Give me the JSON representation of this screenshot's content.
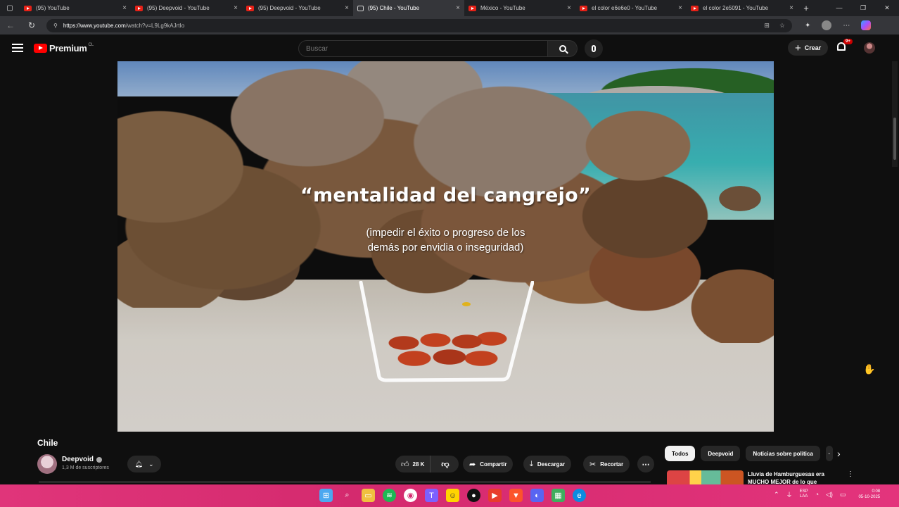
{
  "browser": {
    "tabs": [
      {
        "title": "(95) YouTube",
        "active": false,
        "audio": false
      },
      {
        "title": "(95) Deepvoid - YouTube",
        "active": false,
        "audio": false
      },
      {
        "title": "(95) Deepvoid - YouTube",
        "active": false,
        "audio": false
      },
      {
        "title": "(95) Chile - YouTube",
        "active": true,
        "audio": true
      },
      {
        "title": "México - YouTube",
        "active": false,
        "audio": false
      },
      {
        "title": "el color e6e6e0 - YouTube",
        "active": false,
        "audio": false
      },
      {
        "title": "el color 2e5091 - YouTube",
        "active": false,
        "audio": false
      }
    ],
    "url_host": "https://www.youtube.com",
    "url_path": "/watch?v=L9Lg9kAJrtIo",
    "close_glyph": "×",
    "new_tab_glyph": "+",
    "window_controls": [
      "—",
      "❐",
      "✕"
    ],
    "nav": {
      "back": "←",
      "reload": "↻"
    }
  },
  "youtube": {
    "logo_text": "Premium",
    "country_code": "CL",
    "search_placeholder": "Buscar",
    "create_label": "Crear",
    "notification_badge": "9+"
  },
  "video": {
    "overlay_title": "“mentalidad del cangrejo”",
    "overlay_subtitle_line1": "(impedir el éxito o progreso de los",
    "overlay_subtitle_line2": "demás por envidia o inseguridad)"
  },
  "watch": {
    "title": "Chile",
    "channel_name": "Deepvoid",
    "subscribers": "1,3 M de suscriptores",
    "likes": "28 K",
    "share_label": "Compartir",
    "download_label": "Descargar",
    "clip_label": "Recortar"
  },
  "chips": [
    "Todos",
    "Deepvoid",
    "Noticias sobre política",
    "·"
  ],
  "recommendation": {
    "title": "Lluvia de Hamburguesas era MUCHO MEJOR de lo que"
  },
  "taskbar": {
    "language": "ESP",
    "language_sub": "LAA",
    "time": "0:08",
    "date": "05-10-2025"
  }
}
